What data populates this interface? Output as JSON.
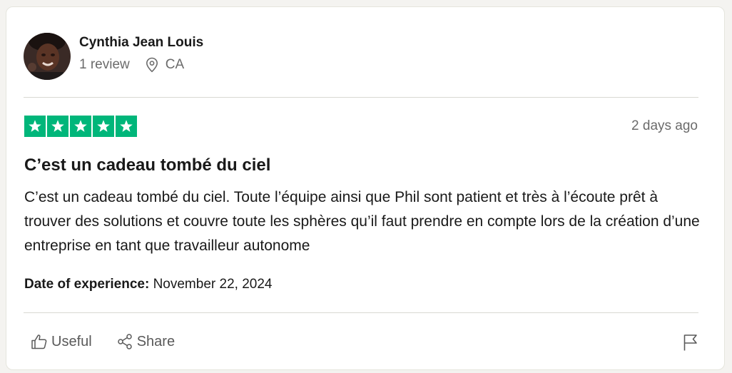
{
  "reviewer": {
    "name": "Cynthia Jean Louis",
    "reviews_count": "1 review",
    "location": "CA"
  },
  "review": {
    "rating": 5,
    "rating_max": 5,
    "posted": "2 days ago",
    "title": "C’est un cadeau tombé du ciel",
    "body": "C’est un cadeau tombé du ciel. Toute l’équipe ainsi que Phil sont patient et très à l’écoute prêt à trouver des solutions et couvre toute les sphères qu’il faut prendre en compte lors de la création d’une entreprise en tant que travailleur autonome",
    "experience_label": "Date of experience:",
    "experience_date": "November 22, 2024"
  },
  "actions": {
    "useful_label": "Useful",
    "share_label": "Share",
    "useful_icon": "thumbs-up-icon",
    "share_icon": "share-icon",
    "flag_icon": "flag-icon"
  },
  "colors": {
    "star_green": "#00b67a",
    "text": "#191919",
    "muted": "#6b6b6b"
  }
}
